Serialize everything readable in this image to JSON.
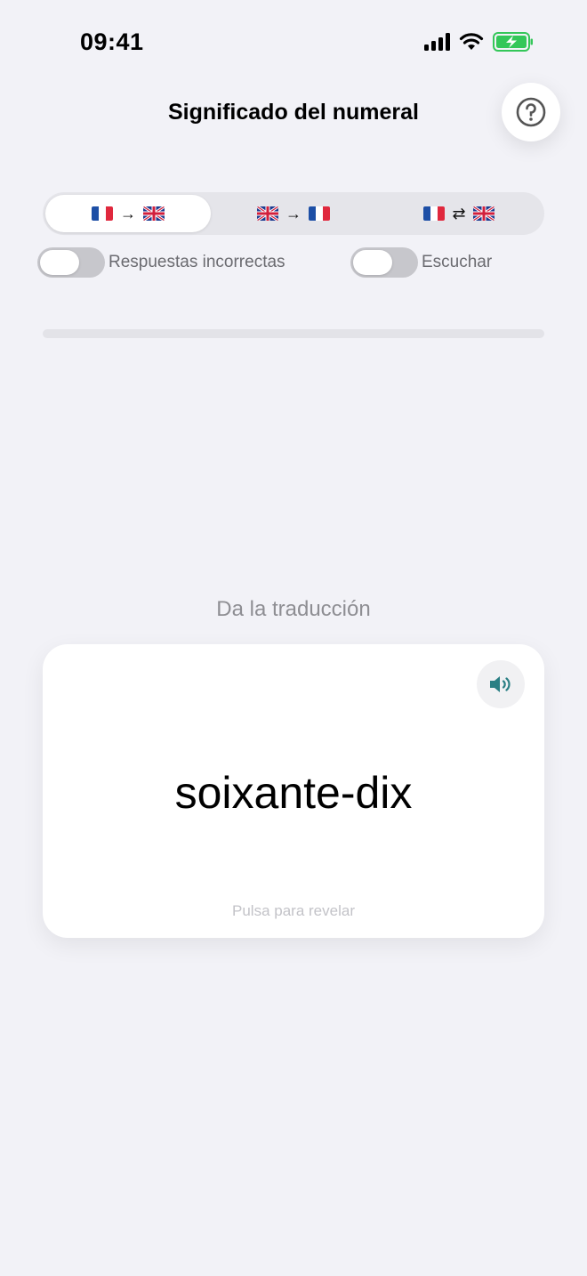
{
  "status_bar": {
    "time": "09:41",
    "battery_color": "#34c759"
  },
  "header": {
    "title": "Significado del numeral",
    "help_icon": "question-circle-icon"
  },
  "direction_selector": {
    "options": [
      {
        "from": "FR",
        "to": "GB",
        "arrow": "→",
        "selected": true
      },
      {
        "from": "GB",
        "to": "FR",
        "arrow": "→",
        "selected": false
      },
      {
        "from": "FR",
        "to": "GB",
        "arrow": "⇄",
        "selected": false
      }
    ]
  },
  "toggles": {
    "incorrect_answers": {
      "label": "Respuestas incorrectas",
      "on": false
    },
    "listen": {
      "label": "Escuchar",
      "on": false
    }
  },
  "progress": {
    "value": 0
  },
  "quiz": {
    "prompt": "Da la traducción",
    "word": "soixante-dix",
    "hint": "Pulsa para revelar",
    "sound_icon": "speaker-icon",
    "accent_color": "#2a7f84"
  }
}
